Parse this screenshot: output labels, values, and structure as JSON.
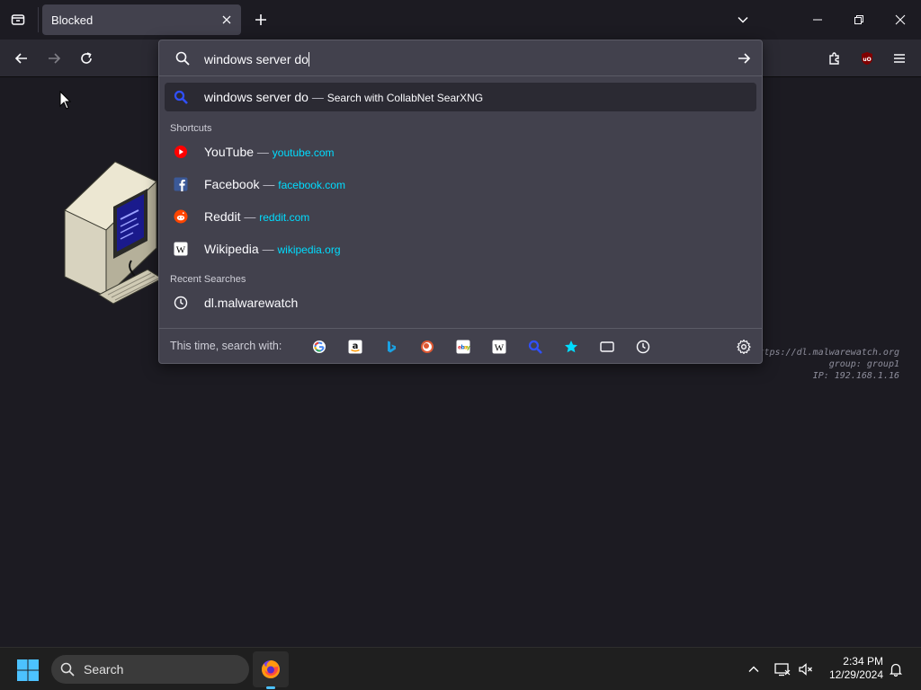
{
  "tabbar": {
    "tab_title": "Blocked"
  },
  "urlbar": {
    "typed_value": "windows server do"
  },
  "suggestion": {
    "query": "windows server do",
    "dash": "—",
    "action": "Search with CollabNet SearXNG"
  },
  "shortcuts": {
    "heading": "Shortcuts",
    "items": [
      {
        "name": "YouTube",
        "url": "youtube.com",
        "icon": "youtube-icon"
      },
      {
        "name": "Facebook",
        "url": "facebook.com",
        "icon": "facebook-icon"
      },
      {
        "name": "Reddit",
        "url": "reddit.com",
        "icon": "reddit-icon"
      },
      {
        "name": "Wikipedia",
        "url": "wikipedia.org",
        "icon": "wikipedia-icon"
      }
    ]
  },
  "recent": {
    "heading": "Recent Searches",
    "items": [
      {
        "text": "dl.malwarewatch"
      }
    ]
  },
  "footer": {
    "label": "This time, search with:",
    "engines": [
      "google-icon",
      "amazon-icon",
      "bing-icon",
      "duckduckgo-icon",
      "ebay-icon",
      "wikipedia-icon",
      "searxng-icon",
      "bookmarks-icon",
      "tabs-icon",
      "history-icon"
    ]
  },
  "page": {
    "info_line1": "https://dl.malwarewatch.org",
    "info_line2": "group: group1",
    "info_line3": "IP: 192.168.1.16"
  },
  "taskbar": {
    "search_label": "Search",
    "time": "2:34 PM",
    "date": "12/29/2024"
  },
  "colors": {
    "accent_link": "#00ddff",
    "panel_bg": "#42414d",
    "toolbar_bg": "#2b2a33",
    "taskbar_indicator": "#4cc2ff"
  }
}
